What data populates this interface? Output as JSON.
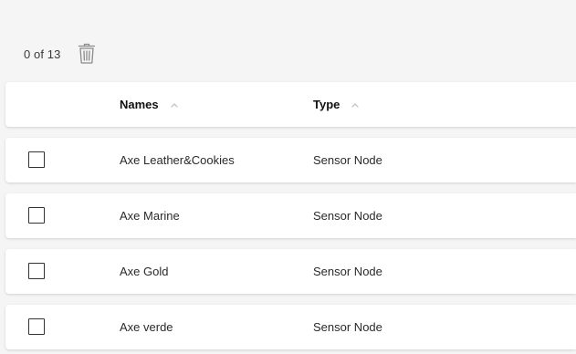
{
  "toolbar": {
    "selection_count": "0 of 13",
    "delete_icon": "trash-icon"
  },
  "table": {
    "columns": [
      {
        "label": "Names",
        "sort_icon": "chevron-up-icon"
      },
      {
        "label": "Type",
        "sort_icon": "chevron-up-icon"
      }
    ],
    "rows": [
      {
        "name": "Axe Leather&Cookies",
        "type": "Sensor Node",
        "checked": false
      },
      {
        "name": "Axe Marine",
        "type": "Sensor Node",
        "checked": false
      },
      {
        "name": "Axe Gold",
        "type": "Sensor Node",
        "checked": false
      },
      {
        "name": "Axe verde",
        "type": "Sensor Node",
        "checked": false
      }
    ]
  },
  "colors": {
    "page_background": "#f5f5f5",
    "card_background": "#ffffff",
    "sort_icon": "#c4c4c4"
  }
}
